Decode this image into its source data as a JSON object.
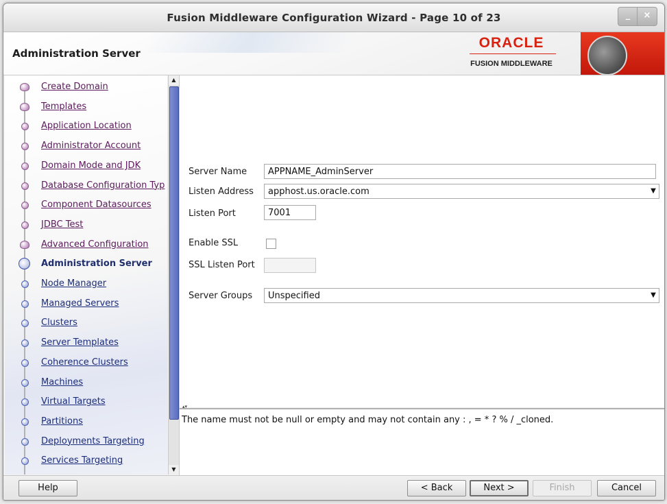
{
  "window": {
    "title": "Fusion Middleware Configuration Wizard - Page 10 of 23",
    "minimize_label": "_",
    "close_label": "×"
  },
  "banner": {
    "heading": "Administration Server",
    "brand": "ORACLE",
    "brand_sub": "FUSION MIDDLEWARE",
    "brand_color": "#d8220f"
  },
  "sidebar": {
    "items": [
      {
        "label": "Create Domain",
        "state": "done"
      },
      {
        "label": "Templates",
        "state": "done"
      },
      {
        "label": "Application Location",
        "state": "visited"
      },
      {
        "label": "Administrator Account",
        "state": "visited"
      },
      {
        "label": "Domain Mode and JDK",
        "state": "visited"
      },
      {
        "label": "Database Configuration Typ",
        "state": "visited"
      },
      {
        "label": "Component Datasources",
        "state": "visited"
      },
      {
        "label": "JDBC Test",
        "state": "visited"
      },
      {
        "label": "Advanced Configuration",
        "state": "done"
      },
      {
        "label": "Administration Server",
        "state": "current"
      },
      {
        "label": "Node Manager",
        "state": "future"
      },
      {
        "label": "Managed Servers",
        "state": "future"
      },
      {
        "label": "Clusters",
        "state": "future"
      },
      {
        "label": "Server Templates",
        "state": "future"
      },
      {
        "label": "Coherence Clusters",
        "state": "future"
      },
      {
        "label": "Machines",
        "state": "future"
      },
      {
        "label": "Virtual Targets",
        "state": "future"
      },
      {
        "label": "Partitions",
        "state": "future"
      },
      {
        "label": "Deployments Targeting",
        "state": "future"
      },
      {
        "label": "Services Targeting",
        "state": "future"
      }
    ],
    "scroll_up": "▲",
    "scroll_down": "▼"
  },
  "form": {
    "server_name": {
      "label": "Server Name",
      "value": "APPNAME_AdminServer"
    },
    "listen_address": {
      "label": "Listen Address",
      "value": "apphost.us.oracle.com"
    },
    "listen_port": {
      "label": "Listen Port",
      "value": "7001"
    },
    "enable_ssl": {
      "label": "Enable SSL",
      "checked": false
    },
    "ssl_listen_port": {
      "label": "SSL Listen Port",
      "value": ""
    },
    "server_groups": {
      "label": "Server Groups",
      "value": "Unspecified"
    }
  },
  "message": {
    "text": "The name must not be null or empty and may not contain any : , = * ? % / _cloned."
  },
  "buttons": {
    "help": "Help",
    "back": "< Back",
    "next": "Next >",
    "finish": "Finish",
    "cancel": "Cancel"
  },
  "icons": {
    "dropdown": "▼",
    "grip": "▴▾"
  }
}
